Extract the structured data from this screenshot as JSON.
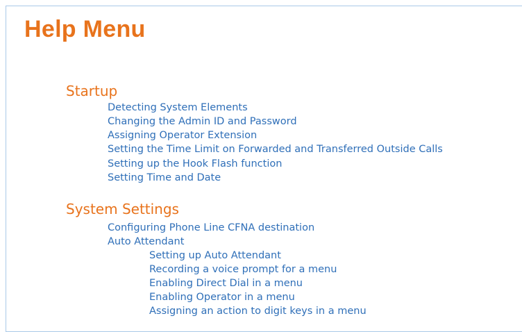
{
  "page": {
    "title": "Help Menu"
  },
  "sections": [
    {
      "heading": "Startup",
      "items": [
        "Detecting System Elements",
        "Changing the Admin ID and Password",
        "Assigning Operator Extension",
        "Setting the Time Limit on Forwarded and Transferred Outside Calls",
        "Setting up the Hook Flash function",
        "Setting Time and Date"
      ]
    },
    {
      "heading": "System Settings",
      "items": [
        "Configuring Phone Line CFNA destination",
        "Auto Attendant"
      ],
      "auto_attendant_items": [
        "Setting up Auto Attendant",
        "Recording a voice prompt for a menu",
        "Enabling Direct Dial in a menu",
        "Enabling Operator in a menu",
        "Assigning an action to digit keys in a menu"
      ]
    }
  ],
  "colors": {
    "heading": "#e8731c",
    "link": "#2f6fb8",
    "border": "#a9c9e8"
  }
}
